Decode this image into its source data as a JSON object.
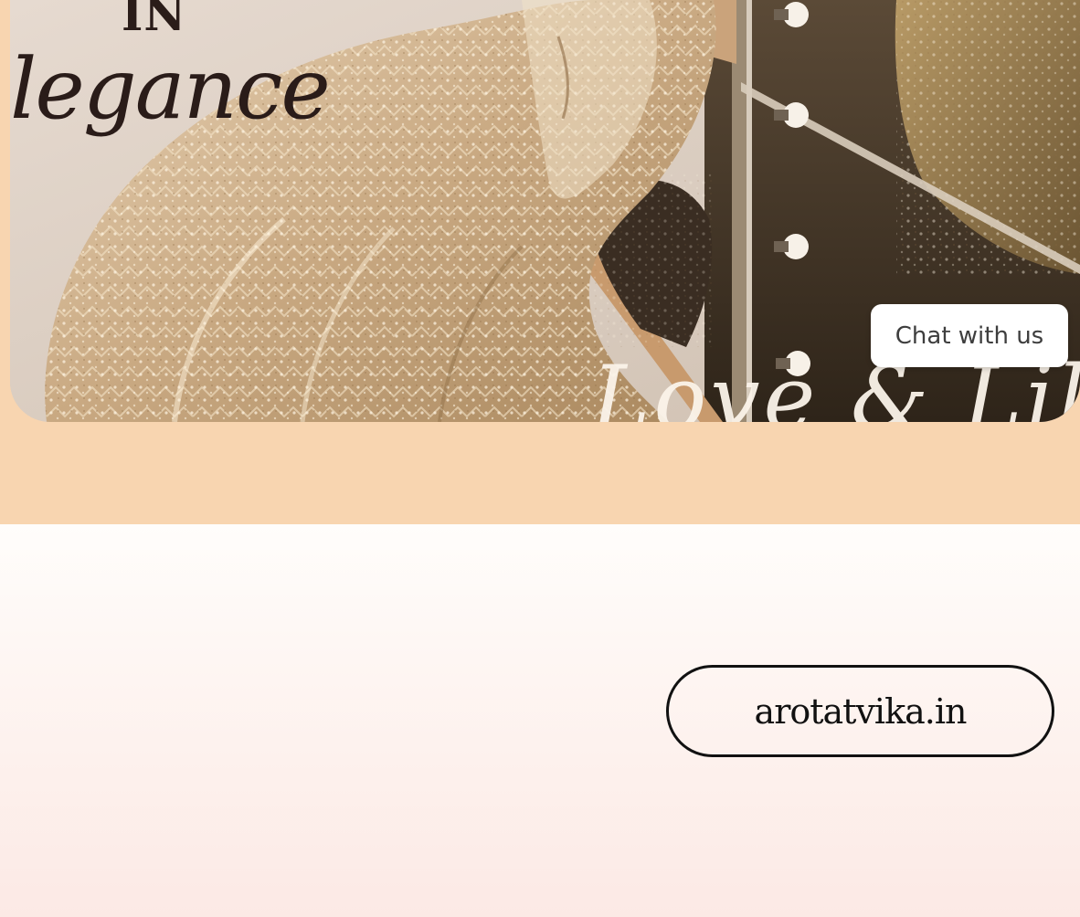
{
  "banner": {
    "headline_small": "IN",
    "headline_script": "legance",
    "signature_script": "Love & Lil",
    "image_description_icon": "bridal-lehenga-photo"
  },
  "chat": {
    "label": "Chat with us"
  },
  "site": {
    "url_label": "arotatvika.in"
  },
  "colors": {
    "peach_band": "#f8d5b0",
    "bottom_gradient_top": "#fffdfb",
    "bottom_gradient_bottom": "#fce9e5",
    "pill_border": "#111111",
    "chat_bg": "#ffffff"
  }
}
